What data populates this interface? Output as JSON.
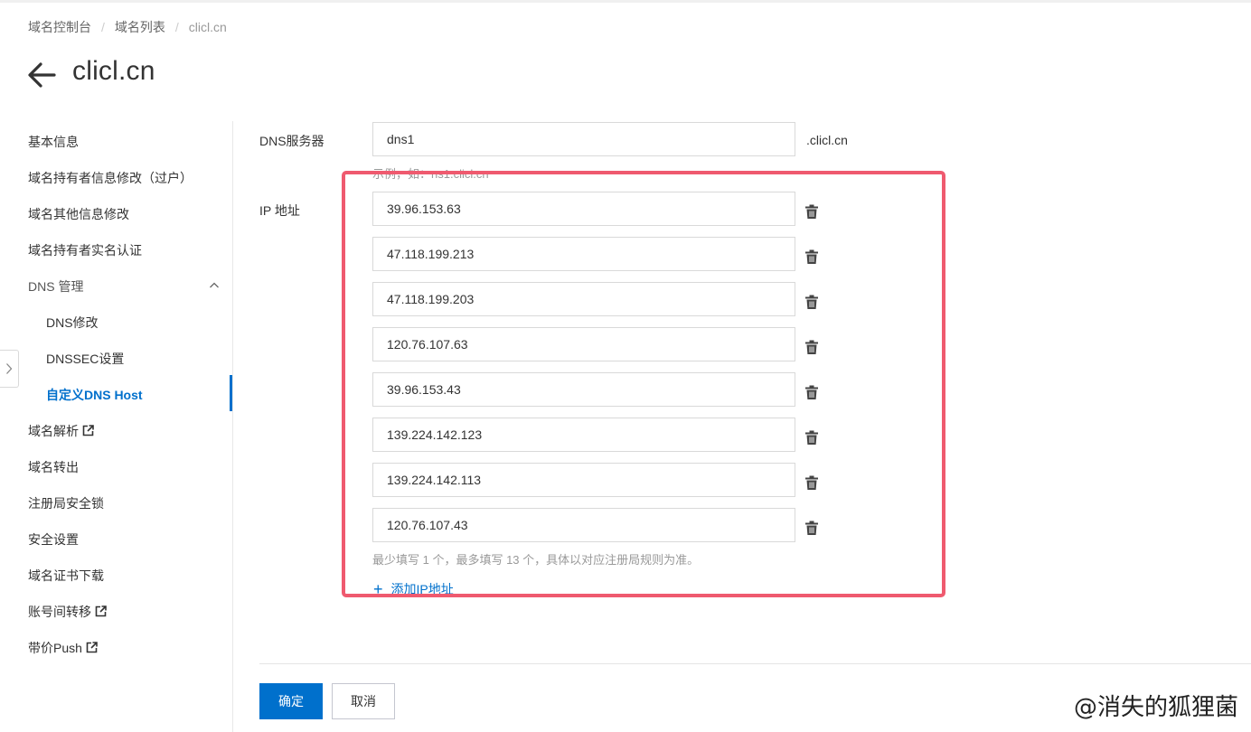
{
  "breadcrumb": [
    "域名控制台",
    "域名列表",
    "clicl.cn"
  ],
  "page": {
    "title": "clicl.cn"
  },
  "sidebar": {
    "items": [
      {
        "label": "基本信息"
      },
      {
        "label": "域名持有者信息修改（过户）"
      },
      {
        "label": "域名其他信息修改"
      },
      {
        "label": "域名持有者实名认证"
      },
      {
        "label": "DNS 管理",
        "expanded": true
      },
      {
        "label": "DNS修改"
      },
      {
        "label": "DNSSEC设置"
      },
      {
        "label": "自定义DNS Host",
        "active": true
      },
      {
        "label": "域名解析",
        "external": true
      },
      {
        "label": "域名转出"
      },
      {
        "label": "注册局安全锁"
      },
      {
        "label": "安全设置"
      },
      {
        "label": "域名证书下载"
      },
      {
        "label": "账号间转移",
        "external": true
      },
      {
        "label": "带价Push",
        "external": true
      }
    ]
  },
  "form": {
    "dns_label": "DNS服务器",
    "dns_value": "dns1",
    "dns_suffix": ".clicl.cn",
    "dns_hint": "示例，如：ns1.clicl.cn",
    "ip_label": "IP 地址",
    "ips": [
      "39.96.153.63",
      "47.118.199.213",
      "47.118.199.203",
      "120.76.107.63",
      "39.96.153.43",
      "139.224.142.123",
      "139.224.142.113",
      "120.76.107.43"
    ],
    "ip_hint": "最少填写 1 个，最多填写 13 个，具体以对应注册局规则为准。",
    "add_ip_label": "添加IP地址"
  },
  "footer": {
    "confirm_label": "确定",
    "cancel_label": "取消"
  },
  "watermark": "@消失的狐狸菌",
  "colors": {
    "accent": "#0070cc",
    "highlight": "#ef5a6f"
  }
}
